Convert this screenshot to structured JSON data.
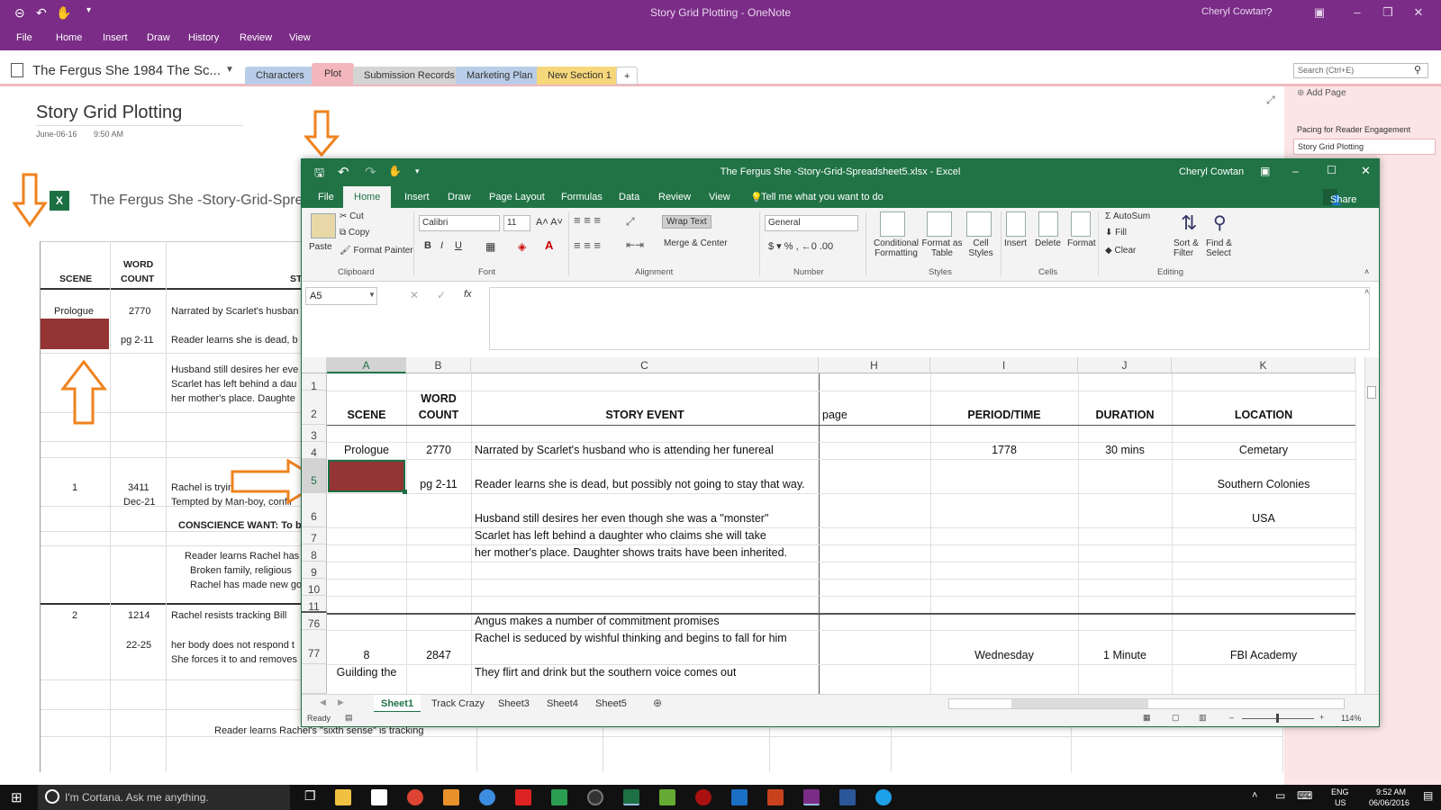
{
  "onenote": {
    "window_title": "Story Grid Plotting - OneNote",
    "user": "Cheryl Cowtan",
    "menu": [
      "File",
      "Home",
      "Insert",
      "Draw",
      "History",
      "Review",
      "View"
    ],
    "notebook": "The Fergus She 1984  The Sc...",
    "sections": [
      {
        "label": "Characters",
        "color": "#b9cde8"
      },
      {
        "label": "Plot",
        "color": "#f4b6bd"
      },
      {
        "label": "Submission Records",
        "color": "#c9c9c9"
      },
      {
        "label": "Marketing Plan",
        "color": "#b9cde8"
      },
      {
        "label": "New Section 1",
        "color": "#f6d77b"
      }
    ],
    "add_section": "+",
    "search_placeholder": "Search (Ctrl+E)",
    "page": {
      "title": "Story Grid Plotting",
      "date": "June-06-16",
      "time": "9:50 AM",
      "embedded_file": "The Fergus She -Story-Grid-Spre"
    },
    "pages_pane": {
      "add_page": "Add Page",
      "items": [
        "Pacing for Reader Engagement",
        "Story Grid Plotting"
      ]
    },
    "bg_table": {
      "head": {
        "scene": "SCENE",
        "word": "WORD",
        "count": "COUNT",
        "story": "ST"
      },
      "rows": [
        {
          "scene": "Prologue",
          "count": "2770",
          "text": "Narrated by Scarlet's husban"
        },
        {
          "scene": "",
          "count": "pg 2-11",
          "text": "Reader learns she is dead, b"
        },
        {
          "scene": "",
          "count": "",
          "text": "Husband still desires her eve"
        },
        {
          "scene": "",
          "count": "",
          "text": "Scarlet has left behind a dau"
        },
        {
          "scene": "",
          "count": "",
          "text": "her mother's place. Daughte"
        },
        {
          "scene": "1",
          "count": "3411",
          "text": "Rachel is trying to change/"
        },
        {
          "scene": "",
          "count": "Dec-21",
          "text": "Tempted by Man-boy, confli"
        },
        {
          "scene": "",
          "count": "",
          "text": "CONSCIENCE WANT: To be"
        },
        {
          "scene": "",
          "count": "",
          "text": "Reader learns Rachel has"
        },
        {
          "scene": "",
          "count": "",
          "text": "Broken family, religious"
        },
        {
          "scene": "",
          "count": "",
          "text": "Rachel has made new go"
        },
        {
          "scene": "2",
          "count": "1214",
          "text": "Rachel resists tracking Bill"
        },
        {
          "scene": "",
          "count": "22-25",
          "text": "her body does not respond t"
        },
        {
          "scene": "",
          "count": "",
          "text": "She forces it to and removes"
        },
        {
          "scene": "",
          "count": "",
          "text": "Reader learns Rachel's \"sixth sense\" is tracking"
        }
      ]
    }
  },
  "excel": {
    "window_title": "The Fergus She -Story-Grid-Spreadsheet5.xlsx - Excel",
    "user": "Cheryl Cowtan",
    "tabs": [
      "File",
      "Home",
      "Insert",
      "Draw",
      "Page Layout",
      "Formulas",
      "Data",
      "Review",
      "View"
    ],
    "tell_me": "Tell me what you want to do",
    "share": "Share",
    "ribbon": {
      "paste": "Paste",
      "cut": "Cut",
      "copy": "Copy",
      "format_painter": "Format Painter",
      "clipboard": "Clipboard",
      "font_name": "Calibri",
      "font_size": "11",
      "font": "Font",
      "wrap_text": "Wrap Text",
      "merge_center": "Merge & Center",
      "alignment": "Alignment",
      "number_format": "General",
      "number": "Number",
      "conditional_formatting": "Conditional Formatting",
      "format_as_table": "Format as Table",
      "cell_styles": "Cell Styles",
      "styles": "Styles",
      "insert": "Insert",
      "delete": "Delete",
      "format": "Format",
      "cells": "Cells",
      "autosum": "AutoSum",
      "fill": "Fill",
      "clear": "Clear",
      "sort_filter": "Sort & Filter",
      "find_select": "Find & Select",
      "editing": "Editing"
    },
    "name_box": "A5",
    "fx": "fx",
    "columns": [
      "A",
      "B",
      "C",
      "H",
      "I",
      "J",
      "K"
    ],
    "rows": [
      {
        "num": "1",
        "A": "",
        "B": "",
        "C": "",
        "H": "",
        "I": "",
        "J": "",
        "K": ""
      },
      {
        "num": "2",
        "A": "SCENE",
        "B1": "WORD",
        "B": "COUNT",
        "C": "STORY EVENT",
        "H": "page",
        "I": "PERIOD/TIME",
        "J": "DURATION",
        "K": "LOCATION"
      },
      {
        "num": "3",
        "A": "",
        "B": "",
        "C": "",
        "H": "",
        "I": "",
        "J": "",
        "K": ""
      },
      {
        "num": "4",
        "A": "Prologue",
        "B": "2770",
        "C": "Narrated by Scarlet's husband who is attending her funereal",
        "H": "",
        "I": "1778",
        "J": "30 mins",
        "K": "Cemetary"
      },
      {
        "num": "5",
        "A": "",
        "B": "pg 2-11",
        "C": "Reader learns she is dead, but possibly not going to stay that way.",
        "H": "",
        "I": "",
        "J": "",
        "K": "Southern Colonies"
      },
      {
        "num": "6",
        "A": "",
        "B": "",
        "C": "Husband still desires her even though she was a \"monster\"",
        "H": "",
        "I": "",
        "J": "",
        "K": "USA"
      },
      {
        "num": "7",
        "A": "",
        "B": "",
        "C": "Scarlet has left behind a daughter who claims she will take",
        "H": "",
        "I": "",
        "J": "",
        "K": ""
      },
      {
        "num": "8",
        "A": "",
        "B": "",
        "C": "her mother's place. Daughter shows traits have been inherited.",
        "H": "",
        "I": "",
        "J": "",
        "K": ""
      },
      {
        "num": "9",
        "A": "",
        "B": "",
        "C": "",
        "H": "",
        "I": "",
        "J": "",
        "K": ""
      },
      {
        "num": "10",
        "A": "",
        "B": "",
        "C": "",
        "H": "",
        "I": "",
        "J": "",
        "K": ""
      },
      {
        "num": "11",
        "A": "",
        "B": "",
        "C": "",
        "H": "",
        "I": "",
        "J": "",
        "K": ""
      },
      {
        "num": "76",
        "A": "",
        "B": "",
        "C": "Angus makes a number of commitment promises",
        "H": "",
        "I": "",
        "J": "",
        "K": ""
      },
      {
        "num": "77",
        "A": "8",
        "B": "2847",
        "C1": "Rachel is seduced by wishful thinking and begins to fall for him",
        "C": "",
        "H": "",
        "I": "Wednesday",
        "J": "1 Minute",
        "K": "FBI Academy"
      },
      {
        "num": "",
        "A": "Guilding the",
        "B": "",
        "C": "They flirt and drink but the southern voice comes out",
        "H": "",
        "I": "",
        "J": "",
        "K": ""
      }
    ],
    "sheets": [
      "Sheet1",
      "Track Crazy",
      "Sheet3",
      "Sheet4",
      "Sheet5"
    ],
    "active_sheet": "Sheet1",
    "status": "Ready",
    "zoom": "114%",
    "fill_color_a5": "#943434"
  },
  "taskbar": {
    "cortana": "I'm Cortana. Ask me anything.",
    "lang1": "ENG",
    "lang2": "US",
    "time": "9:52 AM",
    "date": "06/06/2016"
  },
  "colors": {
    "onenote": "#7a2c86",
    "excel": "#217346",
    "arrow": "#f0821e"
  }
}
